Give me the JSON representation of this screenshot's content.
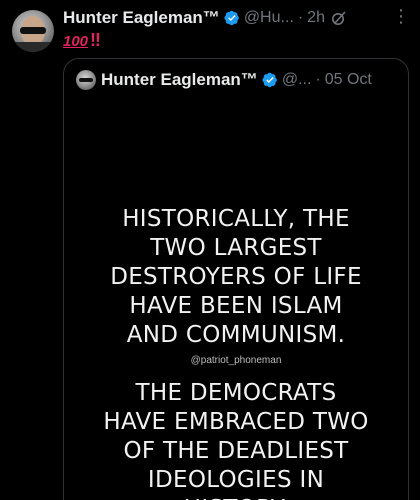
{
  "post": {
    "display_name": "Hunter Eagleman™",
    "handle": "@Hu...",
    "separator": "·",
    "time": "2h",
    "more_icon": "⋮",
    "text_emoji_100": "100",
    "text_emoji_bang": "‼"
  },
  "quote": {
    "display_name": "Hunter Eagleman™",
    "handle": "@...",
    "separator": "·",
    "date": "05 Oct",
    "image": {
      "line_top": "HISTORICALLY, THE\nTWO LARGEST\nDESTROYERS OF LIFE\nHAVE BEEN ISLAM\nAND COMMUNISM.",
      "watermark": "@patriot_phoneman",
      "line_bottom": "THE DEMOCRATS\nHAVE EMBRACED TWO\nOF THE DEADLIEST\nIDEOLOGIES IN\nHISTORY."
    }
  },
  "colors": {
    "background": "#000000",
    "text_primary": "#e7e9ea",
    "text_secondary": "#71767b",
    "verified_blue": "#1d9bf0",
    "border": "#2f3336",
    "emoji_red": "#e0245e"
  },
  "icons": {
    "verified": "verified-badge-icon",
    "grok": "grok-icon",
    "more": "more-options-icon"
  }
}
